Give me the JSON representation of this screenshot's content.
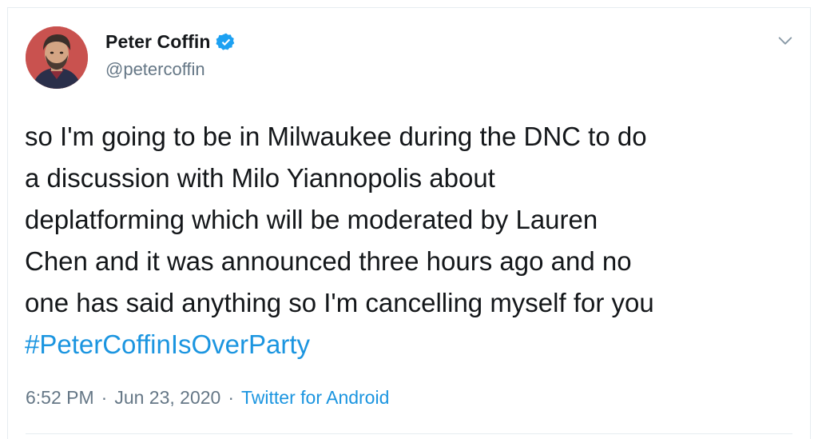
{
  "tweet": {
    "author": {
      "display_name": "Peter Coffin",
      "handle": "@petercoffin",
      "verified": true
    },
    "text_lines": [
      "so I'm going to be in Milwaukee during the DNC to do",
      "a discussion with Milo Yiannopolis about",
      "deplatforming which will be moderated by Lauren",
      "Chen and it was announced three hours ago and no",
      "one has said anything so I'm cancelling myself for you"
    ],
    "hashtag": "#PeterCoffinIsOverParty",
    "time": "6:52 PM",
    "separator": "·",
    "date": "Jun 23, 2020",
    "source": "Twitter for Android"
  },
  "colors": {
    "text": "#14171a",
    "secondary": "#657786",
    "link": "#1b95e0",
    "verified": "#1da1f2",
    "border": "#e6ecf0"
  },
  "icons": {
    "verified": "verified-badge-icon",
    "menu": "chevron-down-icon"
  }
}
